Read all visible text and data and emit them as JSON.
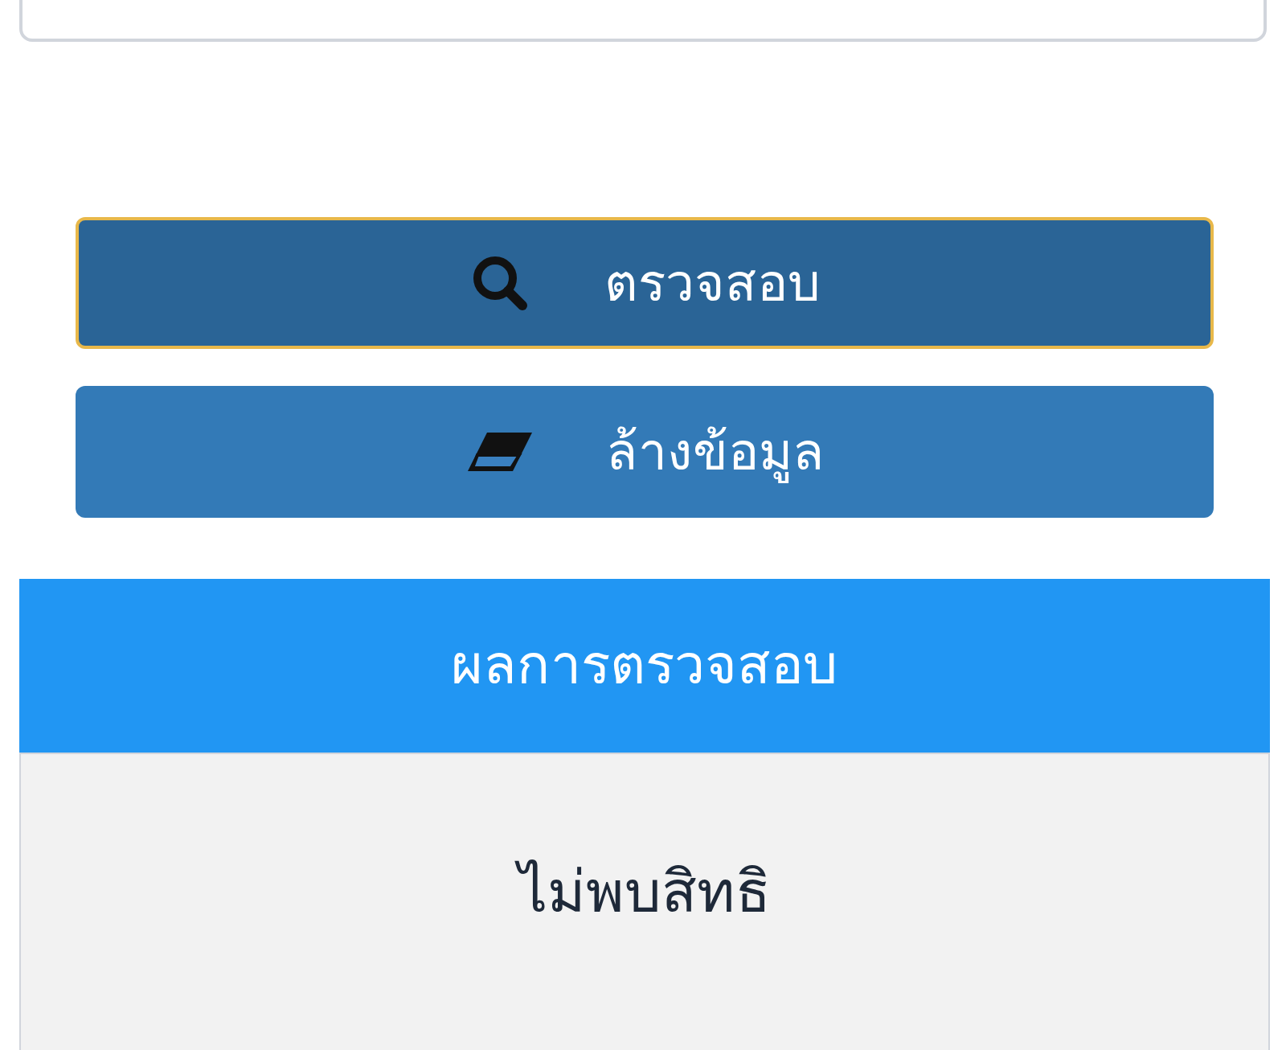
{
  "buttons": [
    {
      "kind": "search",
      "label": "ตรวจสอบ",
      "focused": true
    },
    {
      "kind": "clear",
      "label": "ล้างข้อมูล",
      "focused": false
    }
  ],
  "result": {
    "title": "ผลการตรวจสอบ",
    "message": "ไม่พบสิทธิ"
  }
}
